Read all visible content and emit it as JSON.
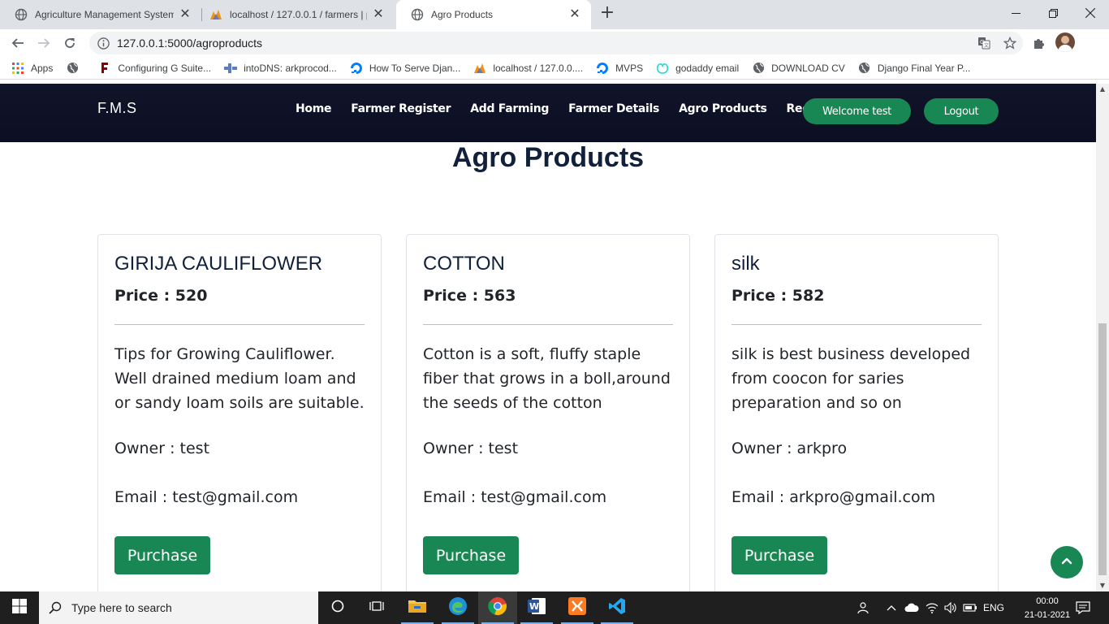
{
  "browser": {
    "tabs": [
      {
        "title": "Agriculture Management System",
        "active": false,
        "icon": "globe-icon"
      },
      {
        "title": "localhost / 127.0.0.1 / farmers | p",
        "active": false,
        "icon": "phpmyadmin-icon"
      },
      {
        "title": "Agro Products",
        "active": true,
        "icon": "globe-icon"
      }
    ],
    "url": "127.0.0.1:5000/agroproducts",
    "bookmarks": [
      {
        "label": "Apps",
        "icon": "apps-grid-icon"
      },
      {
        "label": "",
        "icon": "globe-icon"
      },
      {
        "label": "Configuring G Suite...",
        "icon": "fcc-icon"
      },
      {
        "label": "intoDNS: arkprocod...",
        "icon": "intodns-icon"
      },
      {
        "label": "How To Serve Djan...",
        "icon": "digitalocean-icon"
      },
      {
        "label": "localhost / 127.0.0....",
        "icon": "phpmyadmin-icon"
      },
      {
        "label": "MVPS",
        "icon": "digitalocean-icon"
      },
      {
        "label": "godaddy email",
        "icon": "godaddy-icon"
      },
      {
        "label": "DOWNLOAD CV",
        "icon": "globe-icon"
      },
      {
        "label": "Django Final Year P...",
        "icon": "globe-icon"
      }
    ]
  },
  "site": {
    "brand": "F.M.S",
    "nav": [
      "Home",
      "Farmer Register",
      "Add Farming",
      "Farmer Details",
      "Agro Products",
      "Records"
    ],
    "welcome": "Welcome test",
    "logout": "Logout",
    "page_title": "Agro Products",
    "price_label": "Price : ",
    "owner_label": "Owner : ",
    "email_label": "Email : ",
    "products": [
      {
        "name": "GIRIJA CAULIFLOWER",
        "price": "520",
        "description": "Tips for Growing Cauliflower. Well drained medium loam and or sandy loam soils are suitable.",
        "owner": "test",
        "email": "test@gmail.com",
        "button": "Purchase"
      },
      {
        "name": "COTTON",
        "price": "563",
        "description": "Cotton is a soft, fluffy staple fiber that grows in a boll,around the seeds of the cotton",
        "owner": "test",
        "email": "test@gmail.com",
        "button": "Purchase"
      },
      {
        "name": "silk",
        "price": "582",
        "description": "silk is best business developed from coocon for saries preparation and so on",
        "owner": "arkpro",
        "email": "arkpro@gmail.com",
        "button": "Purchase"
      }
    ],
    "accent_color": "#198754",
    "nav_bg_color": "#0f1125"
  },
  "taskbar": {
    "search_placeholder": "Type here to search",
    "language": "ENG",
    "time": "00:00",
    "date": "21-01-2021"
  }
}
